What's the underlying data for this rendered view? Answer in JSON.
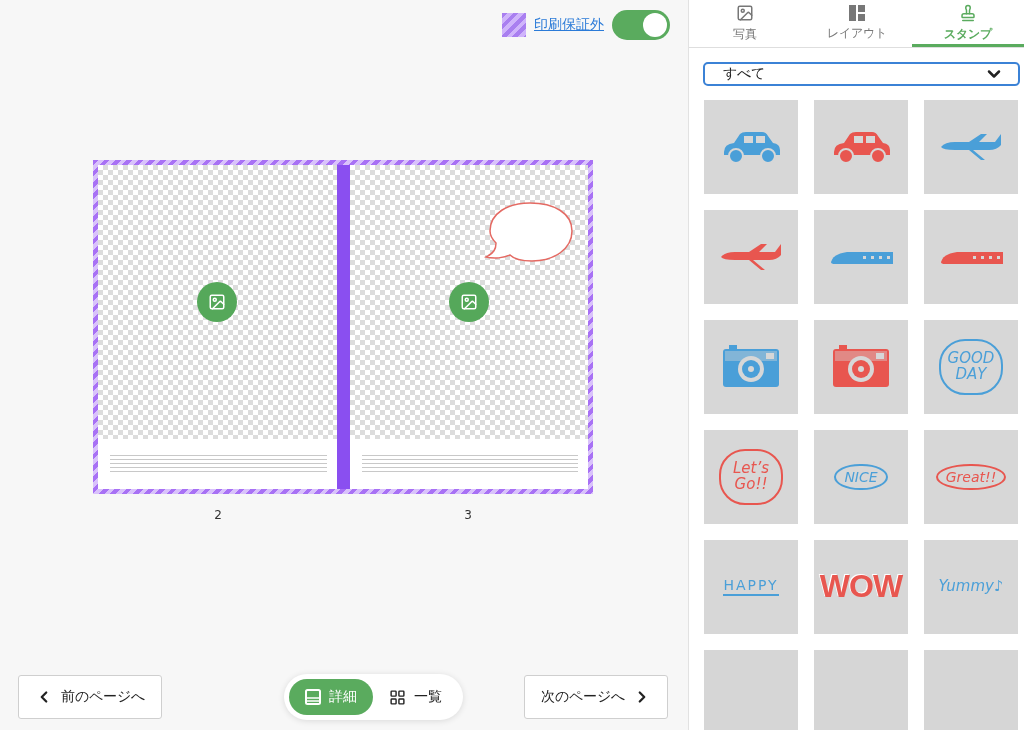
{
  "print_guarantee": {
    "label": "印刷保証外",
    "on": true
  },
  "spread": {
    "pages": [
      {
        "number": "2",
        "speech_bubble": false
      },
      {
        "number": "3",
        "speech_bubble": true
      }
    ]
  },
  "navigation": {
    "previous": "前のページへ",
    "next": "次のページへ"
  },
  "view_modes": [
    {
      "kind": "detail",
      "label": "詳細",
      "selected": true
    },
    {
      "kind": "grid",
      "label": "一覧",
      "selected": false
    }
  ],
  "tabs": [
    {
      "kind": "photo",
      "label": "写真",
      "selected": false
    },
    {
      "kind": "layout",
      "label": "レイアウト",
      "selected": false
    },
    {
      "kind": "stamp",
      "label": "スタンプ",
      "selected": true
    }
  ],
  "category_select": {
    "value": "すべて"
  },
  "stamps": [
    {
      "kind": "car",
      "color": "#4a9fd8"
    },
    {
      "kind": "car",
      "color": "#e8564f"
    },
    {
      "kind": "plane",
      "color": "#4a9fd8"
    },
    {
      "kind": "plane",
      "color": "#e8564f"
    },
    {
      "kind": "train",
      "color": "#4a9fd8"
    },
    {
      "kind": "train",
      "color": "#e8564f"
    },
    {
      "kind": "camera",
      "color": "#4a9fd8"
    },
    {
      "kind": "camera",
      "color": "#e8564f"
    },
    {
      "kind": "cloud",
      "color": "#4a9fd8",
      "text": "GOOD DAY"
    },
    {
      "kind": "cloud",
      "color": "#e8564f",
      "text": "Let’s Go!!"
    },
    {
      "kind": "oval",
      "color": "#4a9fd8",
      "text": "NICE"
    },
    {
      "kind": "oval",
      "color": "#e8564f",
      "text": "Great!!"
    },
    {
      "kind": "underline",
      "color": "#4a9fd8",
      "text": "HAPPY"
    },
    {
      "kind": "block",
      "color": "#e8564f",
      "text": "WOW"
    },
    {
      "kind": "script",
      "color": "#4a9fd8",
      "text": "Yummy♪"
    },
    {
      "kind": "blank",
      "color": "#d6d6d6"
    },
    {
      "kind": "blank",
      "color": "#d6d6d6"
    },
    {
      "kind": "blank",
      "color": "#d6d6d6"
    }
  ]
}
